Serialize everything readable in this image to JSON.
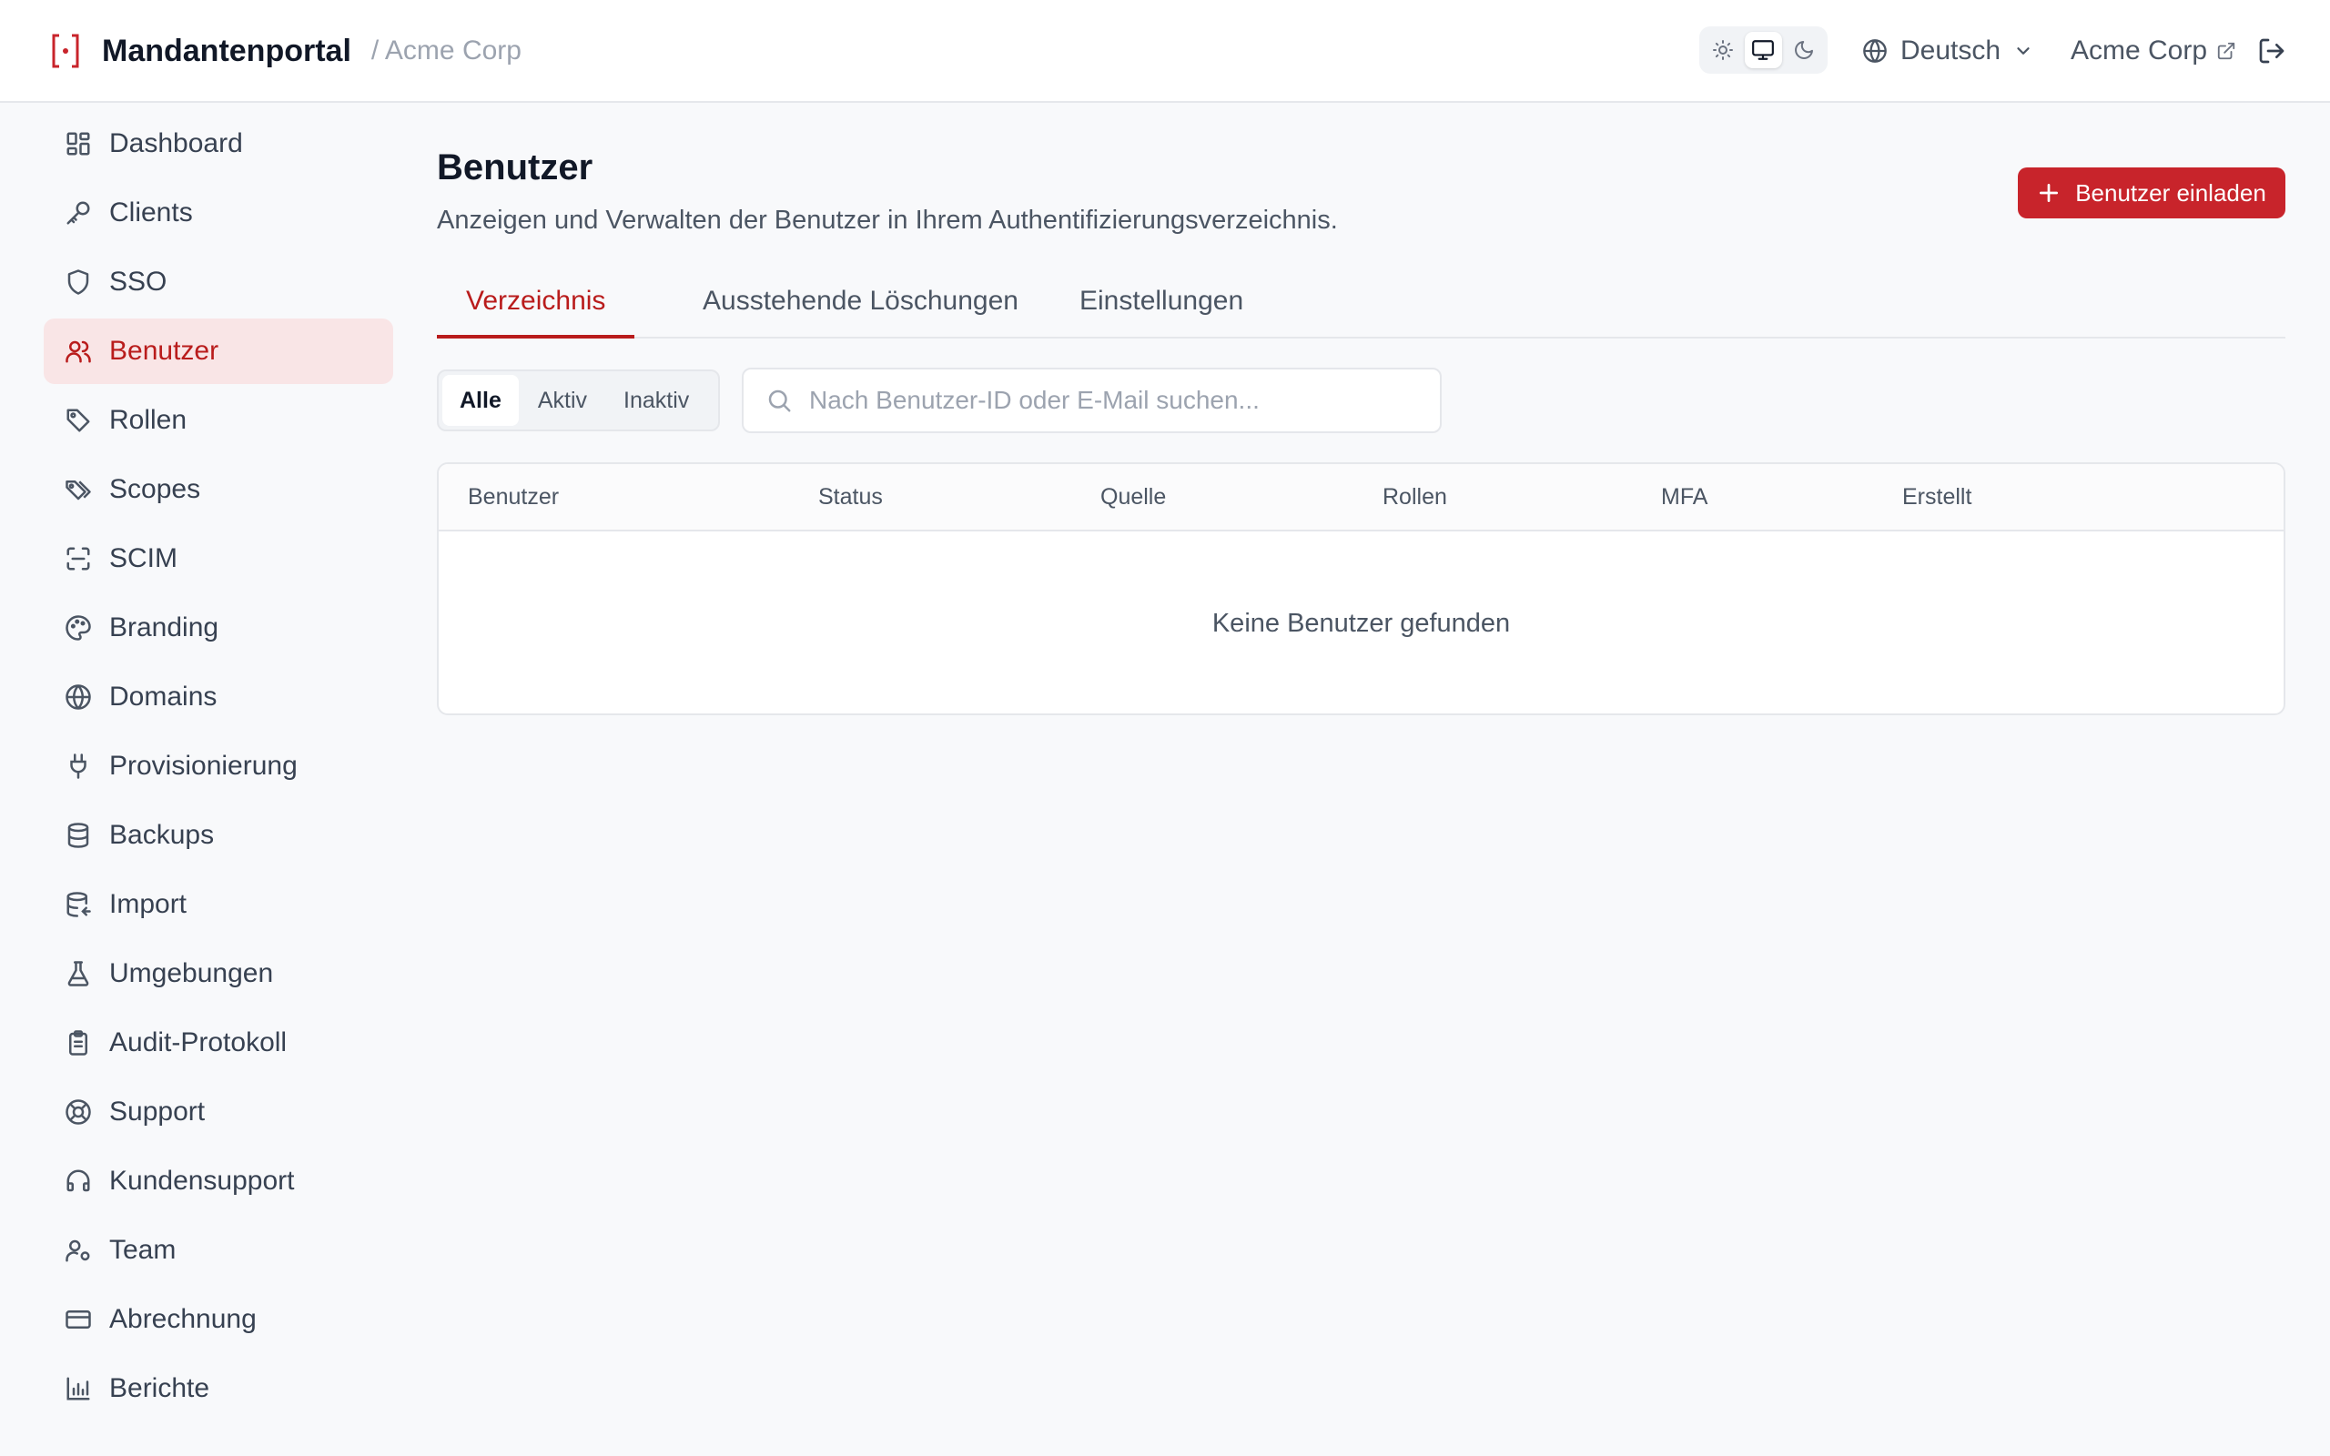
{
  "header": {
    "brand_name": "Mandantenportal",
    "tenant_crumb": "/ Acme Corp",
    "language": "Deutsch",
    "account_name": "Acme Corp",
    "theme_modes": [
      "sun-icon",
      "monitor-icon",
      "moon-icon"
    ],
    "theme_active": "monitor-icon"
  },
  "sidebar": {
    "items": [
      {
        "label": "Dashboard",
        "icon": "dashboard-icon"
      },
      {
        "label": "Clients",
        "icon": "key-icon"
      },
      {
        "label": "SSO",
        "icon": "shield-icon"
      },
      {
        "label": "Benutzer",
        "icon": "users-icon",
        "active": true
      },
      {
        "label": "Rollen",
        "icon": "tag-icon"
      },
      {
        "label": "Scopes",
        "icon": "tags-icon"
      },
      {
        "label": "SCIM",
        "icon": "scan-icon"
      },
      {
        "label": "Branding",
        "icon": "palette-icon"
      },
      {
        "label": "Domains",
        "icon": "globe-icon"
      },
      {
        "label": "Provisionierung",
        "icon": "plug-icon"
      },
      {
        "label": "Backups",
        "icon": "database-icon"
      },
      {
        "label": "Import",
        "icon": "database-import-icon"
      },
      {
        "label": "Umgebungen",
        "icon": "flask-icon"
      },
      {
        "label": "Audit-Protokoll",
        "icon": "clipboard-icon"
      },
      {
        "label": "Support",
        "icon": "lifebuoy-icon"
      },
      {
        "label": "Kundensupport",
        "icon": "headset-icon"
      },
      {
        "label": "Team",
        "icon": "user-cog-icon"
      },
      {
        "label": "Abrechnung",
        "icon": "credit-card-icon"
      },
      {
        "label": "Berichte",
        "icon": "bar-chart-icon"
      }
    ]
  },
  "main": {
    "title": "Benutzer",
    "subtitle": "Anzeigen und Verwalten der Benutzer in Ihrem Authentifizierungsverzeichnis.",
    "invite_label": "Benutzer einladen",
    "tabs": [
      {
        "label": "Verzeichnis",
        "active": true
      },
      {
        "label": "Ausstehende Löschungen"
      },
      {
        "label": "Einstellungen"
      }
    ],
    "filters": [
      {
        "label": "Alle",
        "active": true
      },
      {
        "label": "Aktiv"
      },
      {
        "label": "Inaktiv"
      }
    ],
    "search": {
      "placeholder": "Nach Benutzer-ID oder E-Mail suchen...",
      "value": ""
    },
    "table": {
      "columns": [
        "Benutzer",
        "Status",
        "Quelle",
        "Rollen",
        "MFA",
        "Erstellt"
      ],
      "empty_text": "Keine Benutzer gefunden"
    }
  },
  "colors": {
    "accent": "#c8242b",
    "accent_text": "#b91c1c",
    "active_bg": "#f9e5e6",
    "background": "#f8f9fb"
  }
}
